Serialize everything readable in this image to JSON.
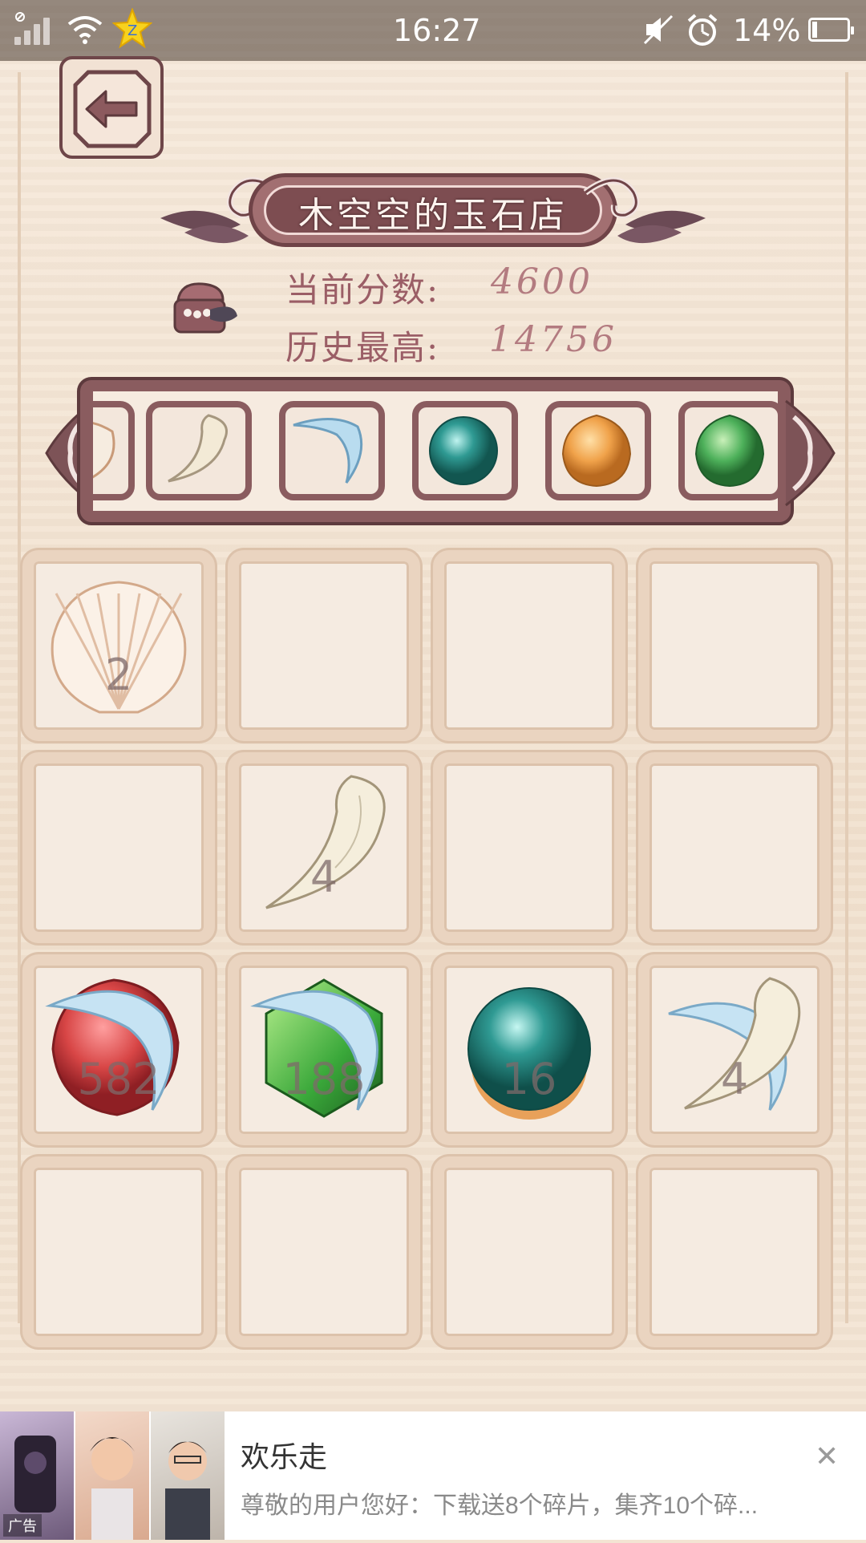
{
  "status_bar": {
    "time": "16:27",
    "battery_text": "14%",
    "battery_level": 0.14,
    "icons": [
      "signal-icon",
      "wifi-icon",
      "qq-star-icon",
      "mute-icon",
      "alarm-icon",
      "battery-icon"
    ]
  },
  "header": {
    "back_icon": "back-arrow-icon",
    "title": "木空空的玉石店"
  },
  "scores": {
    "current_label": "当前分数:",
    "current_value": "4600",
    "best_label": "历史最高:",
    "best_value": "14756"
  },
  "gem_strip": {
    "items": [
      "shell",
      "tooth",
      "blue-claw",
      "teal-pearl",
      "orange-gem",
      "green-gem"
    ]
  },
  "board": {
    "rows": 4,
    "cols": 4,
    "cells": [
      {
        "item": "shell",
        "number": "2"
      },
      {
        "item": "",
        "number": ""
      },
      {
        "item": "",
        "number": ""
      },
      {
        "item": "",
        "number": ""
      },
      {
        "item": "",
        "number": ""
      },
      {
        "item": "tooth",
        "number": "4"
      },
      {
        "item": "",
        "number": ""
      },
      {
        "item": "",
        "number": ""
      },
      {
        "item": "red-gem-claw",
        "number": "582"
      },
      {
        "item": "green-gem-claw",
        "number": "188"
      },
      {
        "item": "teal-pearl",
        "number": "16"
      },
      {
        "item": "tooth-claw",
        "number": "4"
      },
      {
        "item": "",
        "number": ""
      },
      {
        "item": "",
        "number": ""
      },
      {
        "item": "",
        "number": ""
      },
      {
        "item": "",
        "number": ""
      }
    ]
  },
  "ad": {
    "app_name": "欢乐走",
    "description": "尊敬的用户您好：下载送8个碎片，集齐10个碎...",
    "close_icon": "close-icon",
    "ad_label": "广告"
  },
  "colors": {
    "plum": "#8a5c5f",
    "dark_plum": "#6f4347",
    "score_text": "#9b5e66",
    "cell_border": "#ead4c0",
    "parchment": "#f3e4d3"
  }
}
